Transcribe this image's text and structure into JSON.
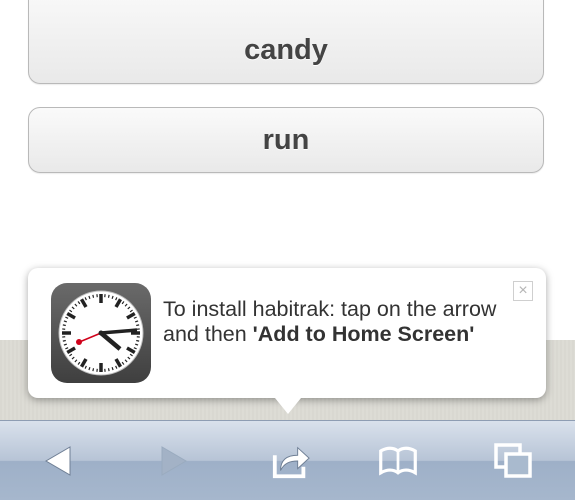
{
  "habits": [
    {
      "label": "candy"
    },
    {
      "label": "run"
    }
  ],
  "install_popup": {
    "app_name": "habitrak",
    "text_plain": "To install habitrak: tap on the arrow and then ",
    "text_bold": "'Add to Home Screen'",
    "close_symbol": "×",
    "icon": "clock-icon"
  },
  "toolbar": {
    "items": [
      "back-icon",
      "forward-icon",
      "share-icon",
      "bookmarks-icon",
      "tabs-icon"
    ]
  },
  "colors": {
    "toolbar": "#b7c4d6",
    "popup_bg": "#ffffff",
    "clock_second_hand": "#d0021b"
  }
}
